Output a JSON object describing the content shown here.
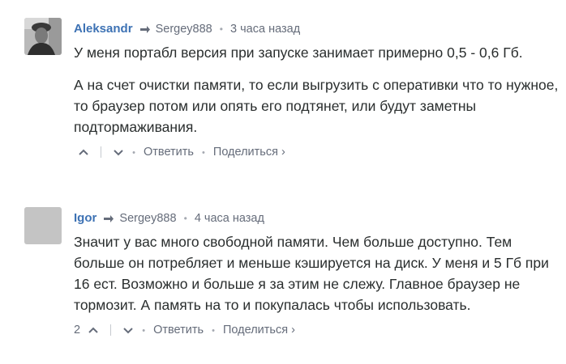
{
  "comments": [
    {
      "author": "Aleksandr",
      "reply_to": "Sergey888",
      "time": "3 часа назад",
      "paragraphs": [
        "У меня портабл версия при запуске занимает примерно 0,5 - 0,6 Гб.",
        "А на счет очистки памяти, то если выгрузить с оперативки что то нужное, то браузер потом или опять его подтянет, или будут заметны подтормаживания."
      ],
      "upvotes": "",
      "reply_label": "Ответить",
      "share_label": "Поделиться",
      "share_chevron": "›"
    },
    {
      "author": "Igor",
      "reply_to": "Sergey888",
      "time": "4 часа назад",
      "paragraphs": [
        "Значит у вас много свободной памяти. Чем больше доступно. Тем больше он потребляет и меньше кэшируется на диск. У меня и 5 Гб при 16 ест. Возможно и больше я за этим не слежу. Главное браузер не тормозит. А память на то и покупалась чтобы использовать."
      ],
      "upvotes": "2",
      "reply_label": "Ответить",
      "share_label": "Поделиться",
      "share_chevron": "›"
    }
  ],
  "colors": {
    "author": "#3d72b4",
    "muted": "#656c7a",
    "text": "#2a2e2e",
    "avatar_placeholder": "#c4c4c4"
  },
  "icons": {
    "reply_arrow": "reply-arrow-icon",
    "upvote": "chevron-up-icon",
    "downvote": "chevron-down-icon"
  }
}
